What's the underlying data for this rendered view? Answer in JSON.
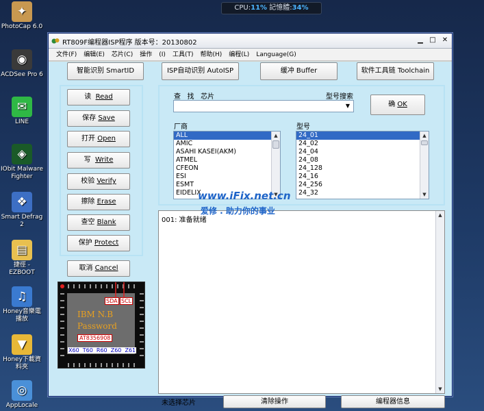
{
  "system_meter": {
    "cpu_label": "CPU:",
    "cpu_value": "11%",
    "mem_label": "記憶體:",
    "mem_value": "34%"
  },
  "desktop_icons": [
    {
      "label": "PhotoCap 6.0",
      "icon": "photocap-icon",
      "color": "#c89850",
      "glyph": "✦"
    },
    {
      "label": "ACDSee Pro 6",
      "icon": "acdsee-icon",
      "color": "#3a3a3a",
      "glyph": "◉"
    },
    {
      "label": "LINE",
      "icon": "line-icon",
      "color": "#2fb845",
      "glyph": "✉"
    },
    {
      "label": "IObit Malware Fighter",
      "icon": "iobit-icon",
      "color": "#1a5a28",
      "glyph": "◈"
    },
    {
      "label": "Smart Defrag 2",
      "icon": "smart-defrag-icon",
      "color": "#3d6fc4",
      "glyph": "❖"
    },
    {
      "label": "捷徑 - EZBOOT",
      "icon": "folder-icon",
      "color": "#e8c050",
      "glyph": "▤"
    },
    {
      "label": "Honey音樂電播放",
      "icon": "music-note-icon",
      "color": "#3a7ad0",
      "glyph": "♫"
    },
    {
      "label": "Honey下載資料夾",
      "icon": "download-folder-icon",
      "color": "#e8b838",
      "glyph": "▼"
    },
    {
      "label": "AppLocale",
      "icon": "applocale-icon",
      "color": "#4a90d8",
      "glyph": "◎"
    }
  ],
  "window": {
    "title": "RT809F编程器ISP程序  版本号：20130802",
    "menu": [
      "文件(F)",
      "编辑(E)",
      "芯片(C)",
      "操作",
      "(I)",
      "工具(T)",
      "帮助(H)",
      "编程(L)",
      "Language(G)"
    ]
  },
  "toolbar": {
    "smart_id": "智能识别 SmartID",
    "auto_isp": "ISP自动识别 AutoISP",
    "buffer": "缓冲   Buffer",
    "toolchain": "软件工具链 Toolchain"
  },
  "left_buttons": [
    {
      "key": "read",
      "zh": "读",
      "en": "Read"
    },
    {
      "key": "save",
      "zh": "保存",
      "en": "Save"
    },
    {
      "key": "open",
      "zh": "打开",
      "en": "Open"
    },
    {
      "key": "write",
      "zh": "写",
      "en": "Write"
    },
    {
      "key": "verify",
      "zh": "校验",
      "en": "Verify"
    },
    {
      "key": "erase",
      "zh": "擦除",
      "en": "Erase"
    },
    {
      "key": "blank",
      "zh": "查空",
      "en": "Blank"
    },
    {
      "key": "protect",
      "zh": "保护",
      "en": "Protect"
    }
  ],
  "cancel_button": {
    "zh": "取消",
    "en": "Cancel"
  },
  "chip_image": {
    "brand": "IBM  N.B",
    "label": "Password",
    "part": "AT8356908",
    "pin_sda": "SDA",
    "pin_scl": "SCL",
    "models": "X60  T60  R60  Z60  Z61"
  },
  "search": {
    "label": "查   找   芯片",
    "search_hint": "型号搜索",
    "ok_zh": "确",
    "ok_en": "OK"
  },
  "manufacturer": {
    "label": "厂商",
    "items": [
      "ALL",
      "AMIC",
      "ASAHI KASEI(AKM)",
      "ATMEL",
      "CFEON",
      "ESI",
      "ESMT",
      "EIDELIX"
    ],
    "selected": 0
  },
  "models": {
    "label": "型号",
    "items": [
      "24_01",
      "24_02",
      "24_04",
      "24_08",
      "24_128",
      "24_16",
      "24_256",
      "24_32"
    ],
    "selected": 0
  },
  "watermark": {
    "line1": "www.iFix.net.cn",
    "line2": "爱修 . 助力你的事业"
  },
  "log": {
    "line1": "001: 准备就绪"
  },
  "statusbar": {
    "cell1": "未选择芯片",
    "cell2": "清除操作",
    "cell3": "编程器信息"
  }
}
